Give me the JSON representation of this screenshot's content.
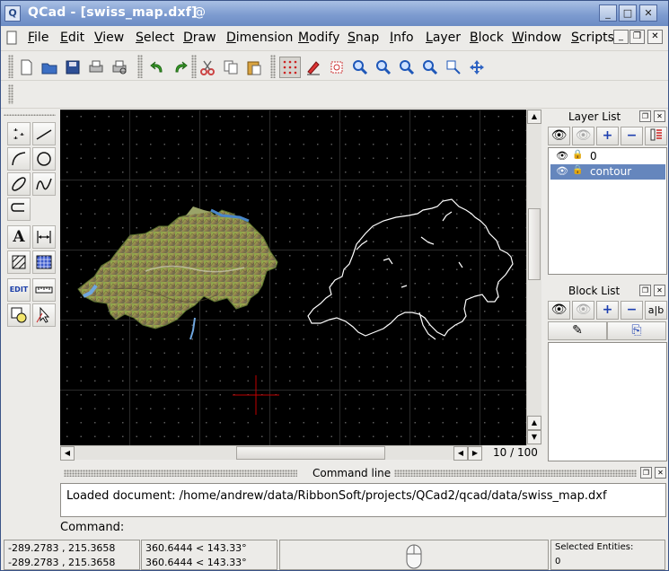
{
  "window": {
    "title": "QCad - [swiss_map.dxf]",
    "app_icon_glyph": "Q",
    "controls": [
      "_",
      "□",
      "✕"
    ]
  },
  "menu": [
    {
      "label": "File",
      "u": "F",
      "rest": "ile"
    },
    {
      "label": "Edit",
      "u": "E",
      "rest": "dit"
    },
    {
      "label": "View",
      "u": "V",
      "rest": "iew"
    },
    {
      "label": "Select",
      "u": "S",
      "rest": "elect"
    },
    {
      "label": "Draw",
      "u": "D",
      "rest": "raw"
    },
    {
      "label": "Dimension",
      "u": "D",
      "rest": "imension"
    },
    {
      "label": "Modify",
      "u": "M",
      "rest": "odify"
    },
    {
      "label": "Snap",
      "u": "S",
      "rest": "nap"
    },
    {
      "label": "Info",
      "u": "I",
      "rest": "nfo"
    },
    {
      "label": "Layer",
      "u": "L",
      "rest": "ayer"
    },
    {
      "label": "Block",
      "u": "B",
      "rest": "lock"
    },
    {
      "label": "Window",
      "u": "W",
      "rest": "indow"
    },
    {
      "label": "Scripts",
      "u": "S",
      "rest": "cripts"
    }
  ],
  "toolbar_icons": [
    "new-file-icon",
    "open-folder-icon",
    "save-icon",
    "print-icon",
    "print-preview-icon",
    "undo-icon",
    "redo-icon",
    "cut-icon",
    "copy-icon",
    "paste-icon",
    "grid-icon",
    "draft-mode-icon",
    "redraw-icon",
    "zoom-in-icon",
    "zoom-out-icon",
    "zoom-auto-icon",
    "zoom-previous-icon",
    "zoom-window-icon",
    "pan-zoom-icon"
  ],
  "left_tools": [
    "points-tool",
    "line-tool",
    "arc-tool",
    "circle-tool",
    "ellipse-tool",
    "spline-tool",
    "polyline-tool",
    "text-tool",
    "dimension-tool",
    "hatch-tool",
    "image-tool",
    "edit-tool",
    "measure-tool",
    "block-tool",
    "select-tool"
  ],
  "layer_list": {
    "title": "Layer List",
    "layers": [
      {
        "name": "0",
        "selected": false
      },
      {
        "name": "contour",
        "selected": true
      }
    ]
  },
  "block_list": {
    "title": "Block List",
    "text_button": "a|b"
  },
  "view": {
    "zoom_text": "10 / 100"
  },
  "command_line": {
    "title": "Command line",
    "output": "Loaded document: /home/andrew/data/RibbonSoft/projects/QCad2/qcad/data/swiss_map.dxf",
    "prompt": "Command:"
  },
  "status_bar": {
    "abs_coord_1": "-289.2783 , 215.3658",
    "abs_coord_2": "-289.2783 , 215.3658",
    "rel_coord_1": "360.6444 < 143.33°",
    "rel_coord_2": "360.6444 < 143.33°",
    "selected_label": "Selected Entities:",
    "selected_count": "0"
  },
  "colors": {
    "titlebar": "#7e9cd0",
    "canvas_bg": "#000000",
    "selection": "#6586bd",
    "crosshair": "#c00000",
    "contour": "#ffffff"
  }
}
